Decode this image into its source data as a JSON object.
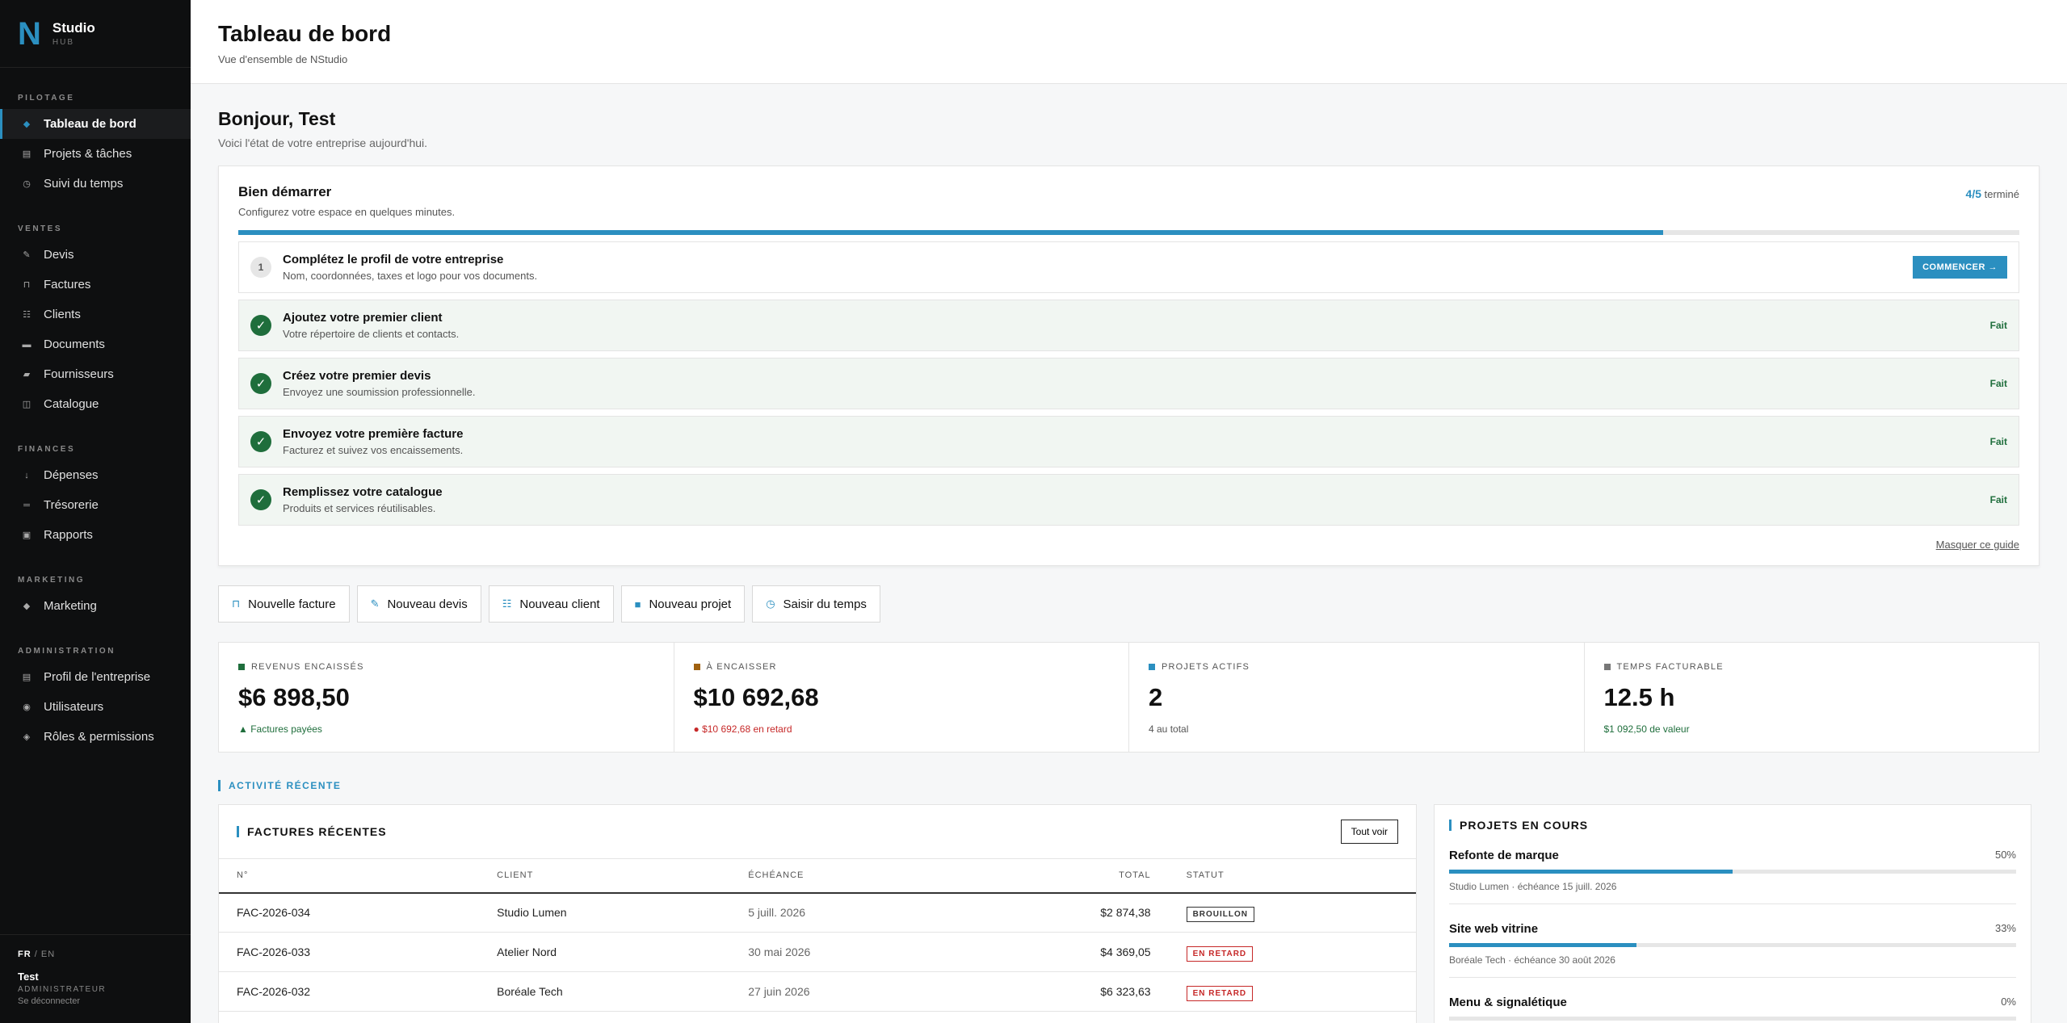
{
  "brand": {
    "logo_letter": "N",
    "name": "Studio",
    "tag": "HUB"
  },
  "nav": {
    "sections": [
      {
        "title": "PILOTAGE",
        "items": [
          {
            "label": "Tableau de bord",
            "icon": "diamond-icon"
          },
          {
            "label": "Projets & tâches",
            "icon": "list-icon"
          },
          {
            "label": "Suivi du temps",
            "icon": "clock-icon"
          }
        ]
      },
      {
        "title": "VENTES",
        "items": [
          {
            "label": "Devis",
            "icon": "pen-icon"
          },
          {
            "label": "Factures",
            "icon": "bag-icon"
          },
          {
            "label": "Clients",
            "icon": "contacts-icon"
          },
          {
            "label": "Documents",
            "icon": "folder-icon"
          },
          {
            "label": "Fournisseurs",
            "icon": "truck-icon"
          },
          {
            "label": "Catalogue",
            "icon": "book-icon"
          }
        ]
      },
      {
        "title": "FINANCES",
        "items": [
          {
            "label": "Dépenses",
            "icon": "arrow-down-icon"
          },
          {
            "label": "Trésorerie",
            "icon": "cash-icon"
          },
          {
            "label": "Rapports",
            "icon": "chart-icon"
          }
        ]
      },
      {
        "title": "MARKETING",
        "items": [
          {
            "label": "Marketing",
            "icon": "diamond-icon"
          }
        ]
      },
      {
        "title": "ADMINISTRATION",
        "items": [
          {
            "label": "Profil de l'entreprise",
            "icon": "building-icon"
          },
          {
            "label": "Utilisateurs",
            "icon": "user-icon"
          },
          {
            "label": "Rôles & permissions",
            "icon": "shield-icon"
          }
        ]
      }
    ]
  },
  "footer": {
    "lang_fr": "FR",
    "lang_sep": "/",
    "lang_en": "EN",
    "user": "Test",
    "role": "ADMINISTRATEUR",
    "logout": "Se déconnecter"
  },
  "header": {
    "title": "Tableau de bord",
    "subtitle": "Vue d'ensemble de NStudio"
  },
  "greeting": {
    "title": "Bonjour, Test",
    "subtitle": "Voici l'état de votre entreprise aujourd'hui."
  },
  "getting_started": {
    "title": "Bien démarrer",
    "subtitle": "Configurez votre espace en quelques minutes.",
    "count": "4/5",
    "count_label": "terminé",
    "progress": 0.8,
    "steps": [
      {
        "num": "1",
        "title": "Complétez le profil de votre entreprise",
        "desc": "Nom, coordonnées, taxes et logo pour vos documents.",
        "done": false,
        "action": "COMMENCER →"
      },
      {
        "title": "Ajoutez votre premier client",
        "desc": "Votre répertoire de clients et contacts.",
        "done": true,
        "action": "Fait"
      },
      {
        "title": "Créez votre premier devis",
        "desc": "Envoyez une soumission professionnelle.",
        "done": true,
        "action": "Fait"
      },
      {
        "title": "Envoyez votre première facture",
        "desc": "Facturez et suivez vos encaissements.",
        "done": true,
        "action": "Fait"
      },
      {
        "title": "Remplissez votre catalogue",
        "desc": "Produits et services réutilisables.",
        "done": true,
        "action": "Fait"
      }
    ],
    "hide_label": "Masquer ce guide"
  },
  "quick_actions": [
    {
      "label": "Nouvelle facture",
      "icon": "bag-icon"
    },
    {
      "label": "Nouveau devis",
      "icon": "pen-icon"
    },
    {
      "label": "Nouveau client",
      "icon": "contacts-icon"
    },
    {
      "label": "Nouveau projet",
      "icon": "square-icon"
    },
    {
      "label": "Saisir du temps",
      "icon": "clock-icon"
    }
  ],
  "kpis": [
    {
      "label": "REVENUS ENCAISSÉS",
      "value": "$6 898,50",
      "sub": "▲ Factures payées",
      "color": "#1f6e3c",
      "subcolor": "#1f6e3c"
    },
    {
      "label": "À ENCAISSER",
      "value": "$10 692,68",
      "sub": "● $10 692,68 en retard",
      "color": "#a0610f",
      "subcolor": "#c62828"
    },
    {
      "label": "PROJETS ACTIFS",
      "value": "2",
      "sub": "4 au total",
      "color": "#2b8fc0",
      "subcolor": "#555555"
    },
    {
      "label": "TEMPS FACTURABLE",
      "value": "12.5 h",
      "sub": "$1 092,50 de valeur",
      "color": "#777777",
      "subcolor": "#1f6e3c"
    }
  ],
  "activity_label": "ACTIVITÉ RÉCENTE",
  "invoices": {
    "title": "FACTURES RÉCENTES",
    "see_all": "Tout voir",
    "columns": [
      "N°",
      "CLIENT",
      "ÉCHÉANCE",
      "TOTAL",
      "STATUT"
    ],
    "rows": [
      {
        "num": "FAC-2026-034",
        "client": "Studio Lumen",
        "due": "5 juill. 2026",
        "total": "$2 874,38",
        "status": "BROUILLON",
        "kind": "draft"
      },
      {
        "num": "FAC-2026-033",
        "client": "Atelier Nord",
        "due": "30 mai 2026",
        "total": "$4 369,05",
        "status": "EN RETARD",
        "kind": "late"
      },
      {
        "num": "FAC-2026-032",
        "client": "Boréale Tech",
        "due": "27 juin 2026",
        "total": "$6 323,63",
        "status": "EN RETARD",
        "kind": "late"
      }
    ]
  },
  "projects": {
    "title": "PROJETS EN COURS",
    "items": [
      {
        "name": "Refonte de marque",
        "percent": "50%",
        "progress": 0.5,
        "meta": "Studio Lumen · échéance 15 juill. 2026"
      },
      {
        "name": "Site web vitrine",
        "percent": "33%",
        "progress": 0.33,
        "meta": "Boréale Tech · échéance 30 août 2026"
      },
      {
        "name": "Menu & signalétique",
        "percent": "0%",
        "progress": 0,
        "meta": ""
      }
    ]
  },
  "colors": {
    "accent": "#2b8fc0",
    "success": "#1f6e3c",
    "danger": "#c62828"
  }
}
